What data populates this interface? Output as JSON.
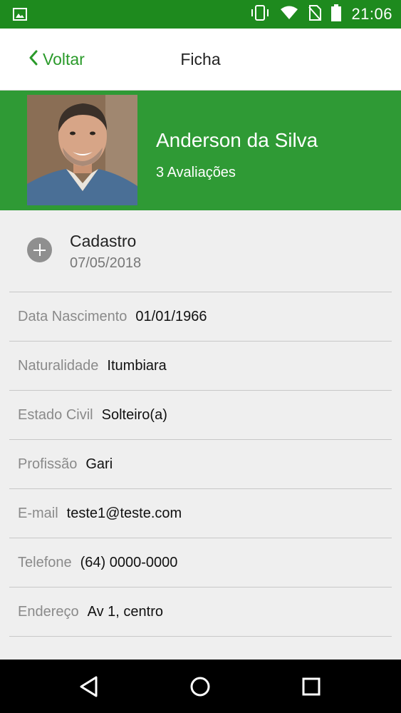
{
  "status_bar": {
    "time": "21:06"
  },
  "app_bar": {
    "back_label": "Voltar",
    "title": "Ficha"
  },
  "profile": {
    "name": "Anderson da Silva",
    "reviews": "3 Avaliações"
  },
  "cadastro": {
    "title": "Cadastro",
    "date": "07/05/2018"
  },
  "fields": [
    {
      "label": "Data Nascimento",
      "value": "01/01/1966"
    },
    {
      "label": "Naturalidade",
      "value": "Itumbiara"
    },
    {
      "label": "Estado Civil",
      "value": "Solteiro(a)"
    },
    {
      "label": "Profissão",
      "value": "Gari"
    },
    {
      "label": "E-mail",
      "value": "teste1@teste.com"
    },
    {
      "label": "Telefone",
      "value": "(64) 0000-0000"
    },
    {
      "label": "Endereço",
      "value": "Av 1, centro"
    }
  ],
  "colors": {
    "status_bar": "#1e8a1e",
    "header": "#2f9a35",
    "accent": "#2a9a2a"
  },
  "icons": [
    "image-icon",
    "vibrate-icon",
    "wifi-icon",
    "no-sim-icon",
    "battery-icon",
    "chevron-left-icon",
    "plus-icon",
    "nav-back-icon",
    "nav-home-icon",
    "nav-recents-icon"
  ]
}
